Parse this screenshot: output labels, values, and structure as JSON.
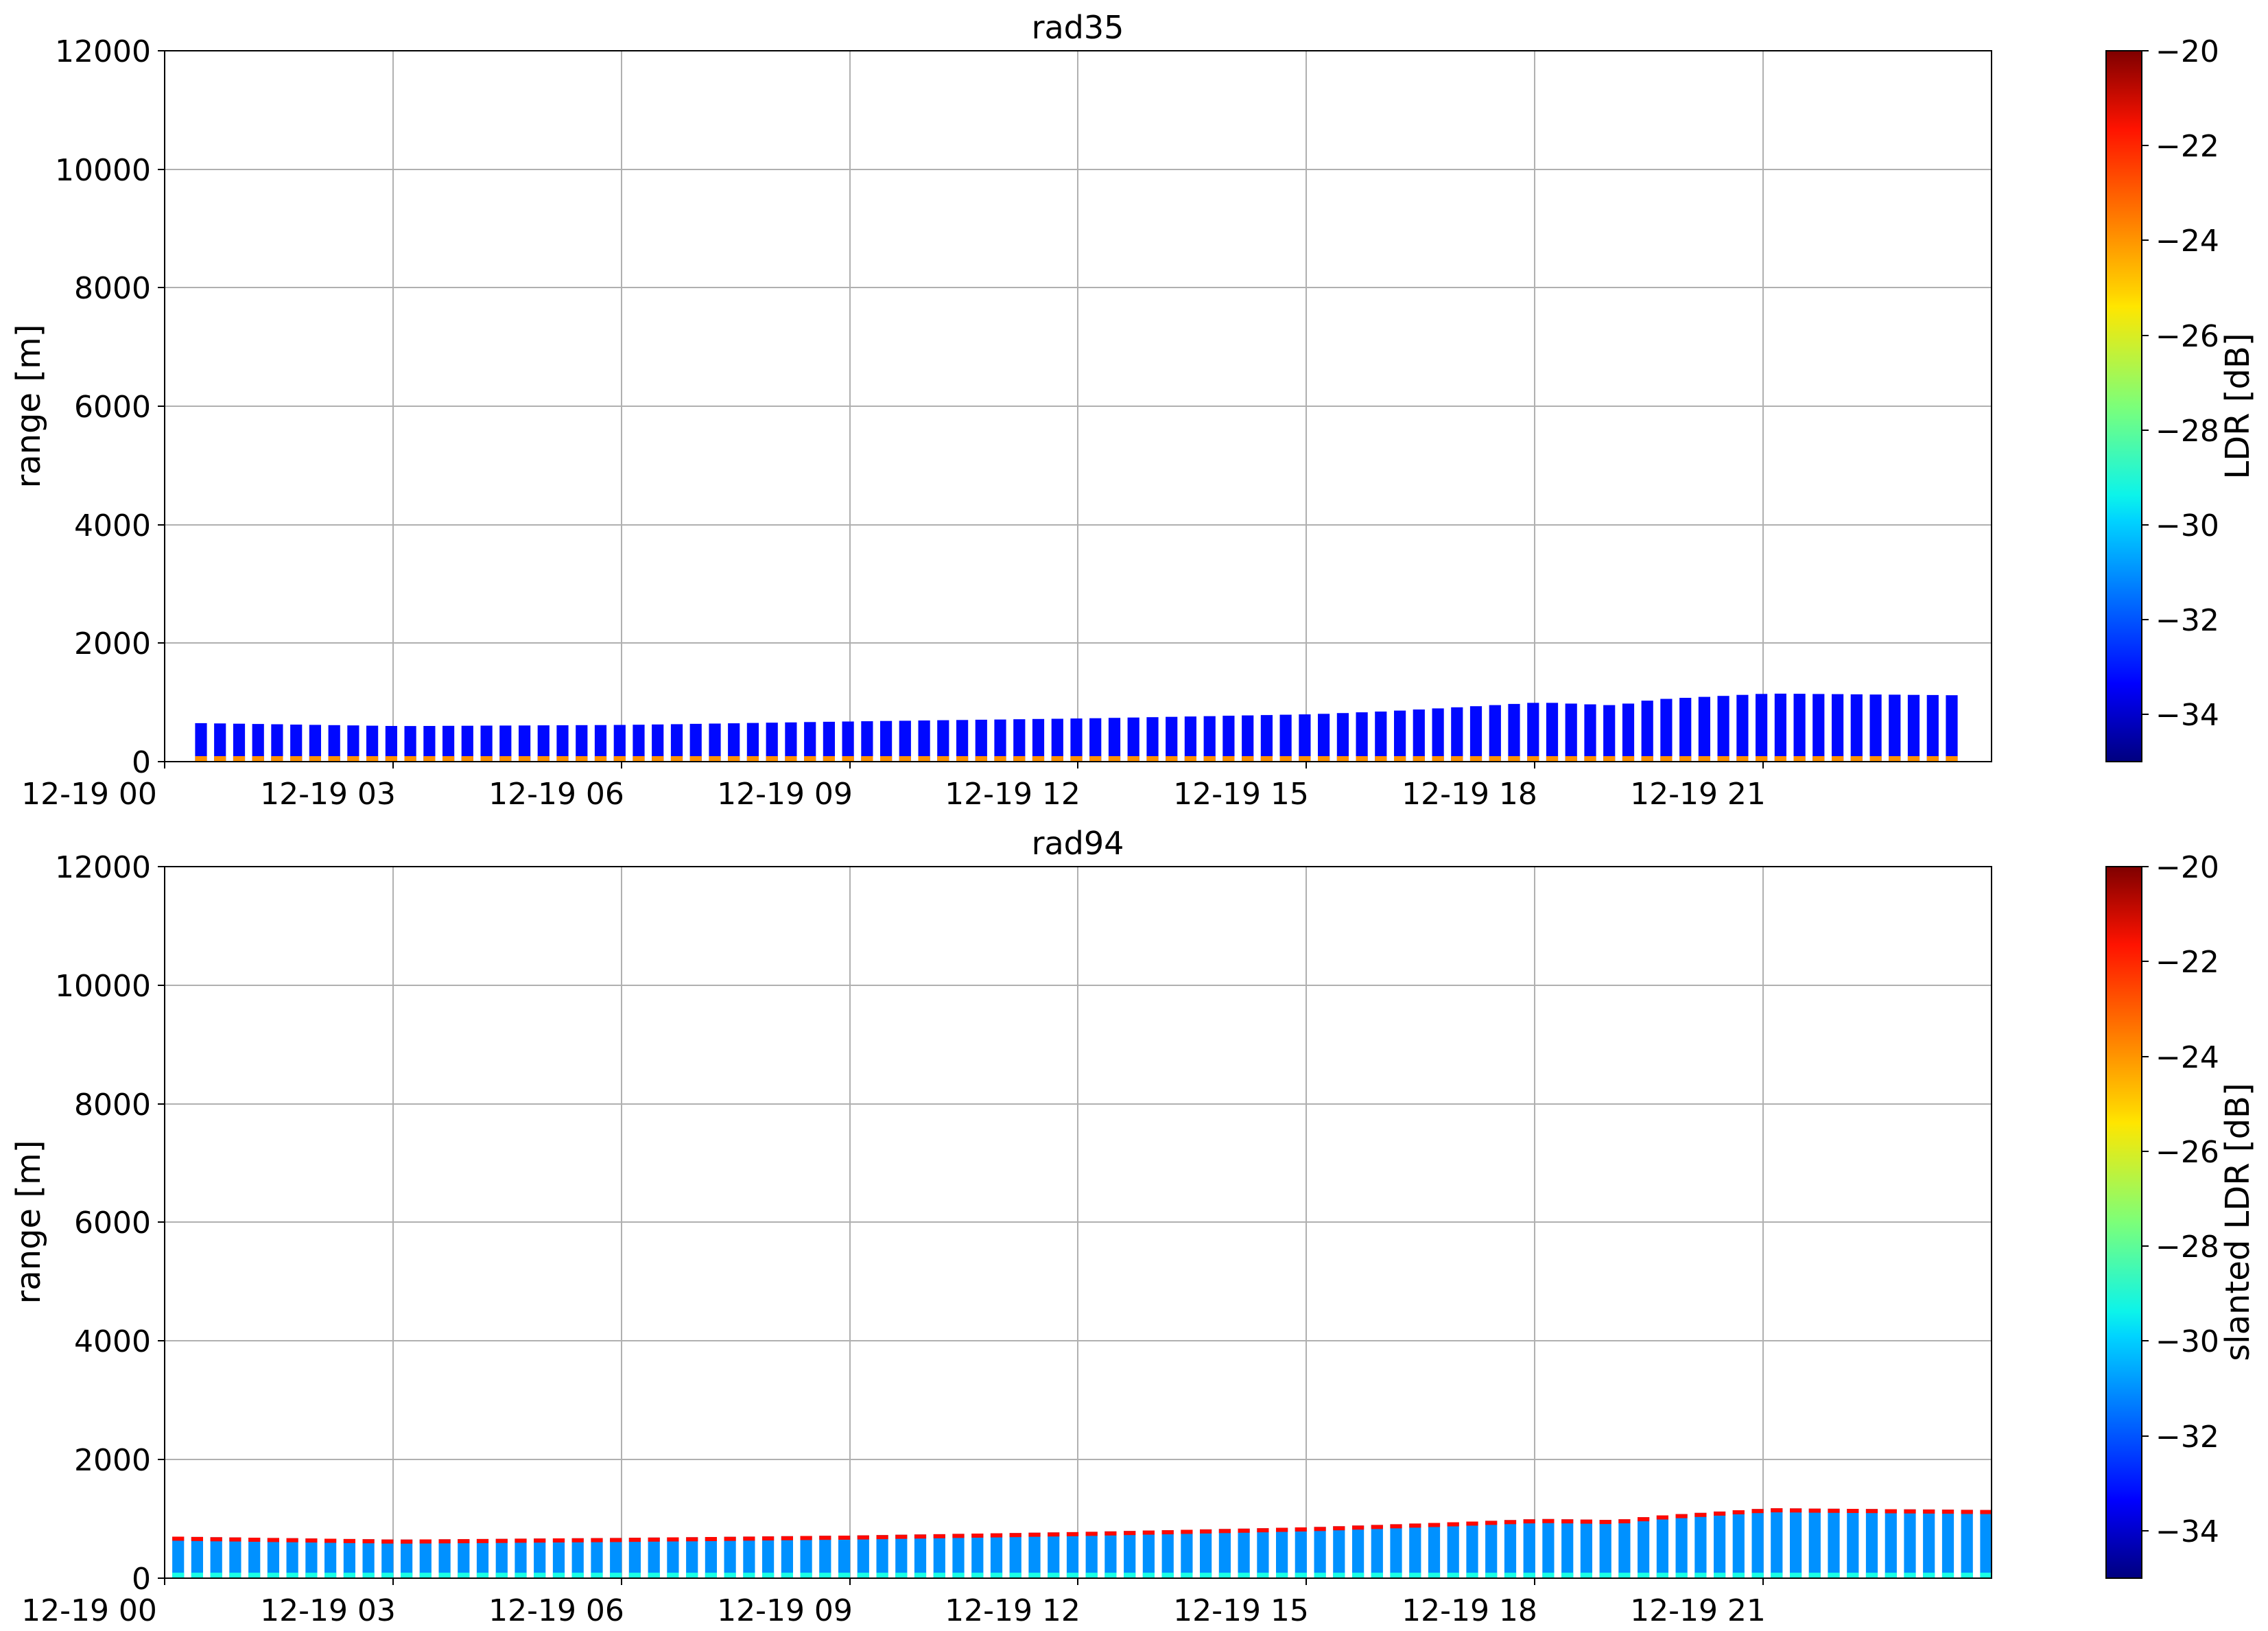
{
  "chart_data": [
    {
      "type": "heatmap",
      "title": "rad35",
      "xlabel": "",
      "ylabel": "range [m]",
      "x_tick_labels": [
        "12-19 00",
        "12-19 03",
        "12-19 06",
        "12-19 09",
        "12-19 12",
        "12-19 15",
        "12-19 18",
        "12-19 21"
      ],
      "xlim_hours": [
        0,
        24
      ],
      "y_ticks": [
        0,
        2000,
        4000,
        6000,
        8000,
        10000,
        12000
      ],
      "ylim": [
        0,
        12000
      ],
      "grid": true,
      "colorbar": {
        "label": "LDR [dB]",
        "ticks": [
          "−20",
          "−22",
          "−24",
          "−26",
          "−28",
          "−30",
          "−32",
          "−34"
        ],
        "tick_values": [
          -20,
          -22,
          -24,
          -26,
          -28,
          -30,
          -32,
          -34
        ],
        "range": [
          -35,
          -20
        ],
        "colormap": "jet"
      },
      "columns": {
        "start_hour": 0.4,
        "end_hour": 23.6,
        "step_hour": 0.25,
        "top_range_profile": [
          [
            0.4,
            650
          ],
          [
            3,
            600
          ],
          [
            6,
            620
          ],
          [
            9,
            680
          ],
          [
            12,
            730
          ],
          [
            15,
            800
          ],
          [
            16,
            850
          ],
          [
            18,
            1000
          ],
          [
            19,
            950
          ],
          [
            19.5,
            1050
          ],
          [
            21,
            1150
          ],
          [
            23.5,
            1120
          ]
        ],
        "dominant_ldr_db": -33,
        "near_ground_ldr_db": -24
      }
    },
    {
      "type": "heatmap",
      "title": "rad94",
      "xlabel": "",
      "ylabel": "range [m]",
      "x_tick_labels": [
        "12-19 00",
        "12-19 03",
        "12-19 06",
        "12-19 09",
        "12-19 12",
        "12-19 15",
        "12-19 18",
        "12-19 21"
      ],
      "xlim_hours": [
        0,
        24
      ],
      "y_ticks": [
        0,
        2000,
        4000,
        6000,
        8000,
        10000,
        12000
      ],
      "ylim": [
        0,
        12000
      ],
      "grid": true,
      "colorbar": {
        "label": "slanted LDR [dB]",
        "ticks": [
          "−20",
          "−22",
          "−24",
          "−26",
          "−28",
          "−30",
          "−32",
          "−34"
        ],
        "tick_values": [
          -20,
          -22,
          -24,
          -26,
          -28,
          -30,
          -32,
          -34
        ],
        "range": [
          -35,
          -20
        ],
        "colormap": "jet"
      },
      "columns": {
        "start_hour": 0.1,
        "end_hour": 23.9,
        "step_hour": 0.25,
        "top_range_profile": [
          [
            0.1,
            700
          ],
          [
            3,
            650
          ],
          [
            6,
            680
          ],
          [
            9,
            720
          ],
          [
            12,
            780
          ],
          [
            15,
            860
          ],
          [
            17,
            950
          ],
          [
            18,
            1000
          ],
          [
            19,
            980
          ],
          [
            19.5,
            1050
          ],
          [
            21,
            1180
          ],
          [
            23.9,
            1150
          ]
        ],
        "dominant_ldr_db": -31,
        "near_ground_ldr_db": -29,
        "top_edge_ldr_db": -22
      }
    }
  ]
}
